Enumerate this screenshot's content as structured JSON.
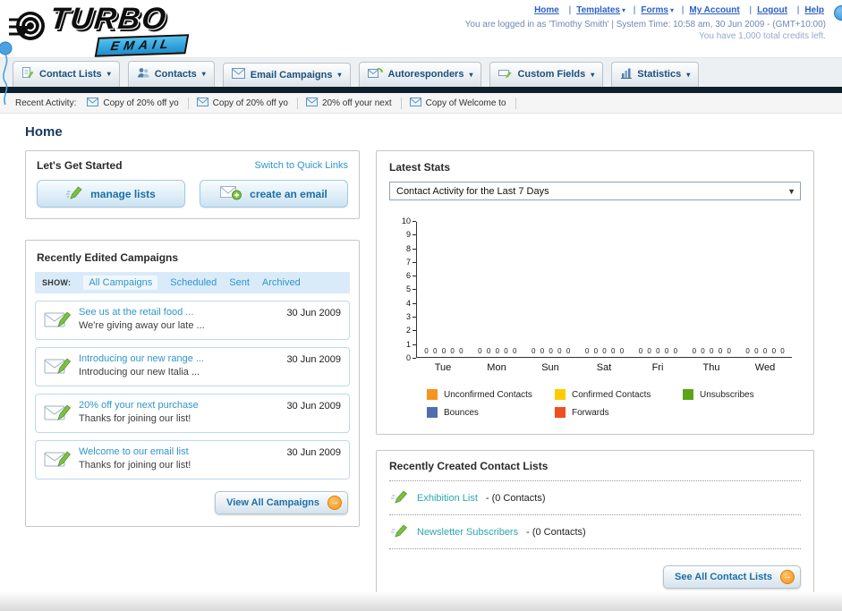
{
  "header": {
    "logo_line1": "TURBO",
    "logo_line2": "EMAIL",
    "links": [
      {
        "label": "Home",
        "arrow": ""
      },
      {
        "label": "Templates",
        "arrow": "▾"
      },
      {
        "label": "Forms",
        "arrow": "▾"
      },
      {
        "label": "My Account",
        "arrow": ""
      },
      {
        "label": "Logout",
        "arrow": ""
      },
      {
        "label": "Help",
        "arrow": ""
      }
    ],
    "login_info": "You are logged in as 'Timothy Smith' | System Time: 10:58 am, 30 Jun 2009 - (GMT+10:00)",
    "credits": "You have 1,000 total credits left."
  },
  "nav": {
    "tabs": [
      {
        "label": "Contact Lists"
      },
      {
        "label": "Contacts"
      },
      {
        "label": "Email Campaigns"
      },
      {
        "label": "Autoresponders"
      },
      {
        "label": "Custom Fields"
      },
      {
        "label": "Statistics"
      }
    ]
  },
  "activity": {
    "label": "Recent Activity:",
    "items": [
      "Copy of 20% off yo",
      "Copy of 20% off yo",
      "20% off your next",
      "Copy of Welcome to"
    ]
  },
  "page_title": "Home",
  "get_started": {
    "title": "Let's Get Started",
    "switch_link": "Switch to Quick Links",
    "manage_lists_label": "manage lists",
    "create_email_label": "create an email"
  },
  "campaigns": {
    "title": "Recently Edited Campaigns",
    "show_label": "SHOW:",
    "filters": [
      {
        "label": "All Campaigns",
        "active": true
      },
      {
        "label": "Scheduled",
        "active": false
      },
      {
        "label": "Sent",
        "active": false
      },
      {
        "label": "Archived",
        "active": false
      }
    ],
    "items": [
      {
        "title": "See us at the retail food ...",
        "subtitle": "We're giving away our late ...",
        "date": "30 Jun 2009"
      },
      {
        "title": "Introducing our new range ...",
        "subtitle": "Introducing our new Italia ...",
        "date": "30 Jun 2009"
      },
      {
        "title": "20% off your next purchase",
        "subtitle": "Thanks for joining our list!",
        "date": "30 Jun 2009"
      },
      {
        "title": "Welcome to our email list",
        "subtitle": "Thanks for joining our list!",
        "date": "30 Jun 2009"
      }
    ],
    "view_all_label": "View All Campaigns"
  },
  "stats": {
    "title": "Latest Stats",
    "dropdown_value": "Contact Activity for the Last 7 Days",
    "chart_data": {
      "type": "bar",
      "title": "Contact Activity for the Last 7 Days",
      "categories": [
        "Tue",
        "Mon",
        "Sun",
        "Sat",
        "Fri",
        "Thu",
        "Wed"
      ],
      "series": [
        {
          "name": "Unconfirmed Contacts",
          "color": "#f7941e",
          "values": [
            0,
            0,
            0,
            0,
            0,
            0,
            0
          ]
        },
        {
          "name": "Confirmed Contacts",
          "color": "#ffcc00",
          "values": [
            0,
            0,
            0,
            0,
            0,
            0,
            0
          ]
        },
        {
          "name": "Unsubscribes",
          "color": "#5aa515",
          "values": [
            0,
            0,
            0,
            0,
            0,
            0,
            0
          ]
        },
        {
          "name": "Bounces",
          "color": "#4f6eb0",
          "values": [
            0,
            0,
            0,
            0,
            0,
            0,
            0
          ]
        },
        {
          "name": "Forwards",
          "color": "#ee4f1e",
          "values": [
            0,
            0,
            0,
            0,
            0,
            0,
            0
          ]
        }
      ],
      "ylim": [
        0,
        10
      ],
      "yticks": [
        10,
        9,
        8,
        7,
        6,
        5,
        4,
        3,
        2,
        1,
        0
      ],
      "xlabel": "",
      "ylabel": "",
      "grid": false,
      "legend_position": "bottom"
    }
  },
  "contact_lists": {
    "title": "Recently Created Contact Lists",
    "items": [
      {
        "name": "Exhibition List",
        "detail": "- (0 Contacts)"
      },
      {
        "name": "Newsletter Subscribers",
        "detail": "- (0 Contacts)"
      }
    ],
    "see_all_label": "See All Contact Lists"
  }
}
